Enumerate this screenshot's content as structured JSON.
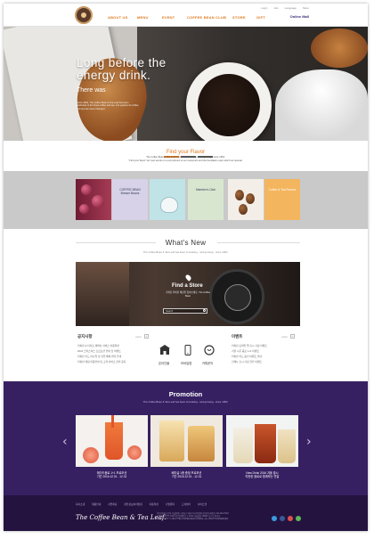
{
  "header": {
    "nav": [
      "ABOUT US",
      "MENU",
      "EVENT",
      "COFFEE BEAN CLUB",
      "STORE",
      "GIFT"
    ],
    "utilities": [
      "Login",
      "Join",
      "Language",
      "Store"
    ],
    "online_mall": "Online Mall"
  },
  "hero": {
    "title": "Long before the energy drink.",
    "subtitle": "There was",
    "copy": "Since 1963, The Coffee Bean & Tea Leaf has been dedicated to the finest coffee and tea. Our passion for coffee and tea has never changed."
  },
  "flavor": {
    "title": "Find your Flavor",
    "desc_1": "The Coffee Bean & Tea Leaf has been innovating - and growing - since 1963.",
    "desc_2": "\"Find your flavor\" isn't just words on a commitment to our customers and the foundation upon which we operate."
  },
  "categories": [
    {
      "label": ""
    },
    {
      "label": "COFFEE BEAN Brewer Beans"
    },
    {
      "label": ""
    },
    {
      "label": "Member's Club"
    },
    {
      "label": ""
    },
    {
      "label": "Coffee & Tea Flavors"
    }
  ],
  "whats_new": {
    "title": "What's New",
    "subtitle": "The Coffee Bean & Tea Leaf has been innovating - and growing - since 1963."
  },
  "store_finder": {
    "title": "Find a Store",
    "copy": "가까운 커피빈 매장을 찾아보세요. The Coffee Bean",
    "search_placeholder": "Search"
  },
  "notices": {
    "title": "공지사항",
    "more": "more",
    "items": [
      "커피빈 & 티리프 멤버십 서비스 이용약관",
      "2016 크리스마스 프로모션 안내 및 이벤트",
      "커피빈 카드 리뉴얼 및 적립 혜택 변경 안내",
      "커피빈 매장 이용안내 및 고객 서비스 관련 공지"
    ]
  },
  "services": [
    {
      "label": "온라인몰",
      "icon": "store-icon"
    },
    {
      "label": "모바일앱",
      "icon": "mobile-icon"
    },
    {
      "label": "카톡문의",
      "icon": "chat-icon"
    }
  ],
  "events": {
    "title": "이벤트",
    "more": "more",
    "items": [
      "커피빈 모바일 앱 출시 기념 이벤트",
      "겨울 시즌 음료 1+1 이벤트",
      "커피빈 카드 충전 이벤트 안내",
      "신메뉴 출시 기념 할인 이벤트"
    ]
  },
  "promotion": {
    "title": "Promotion",
    "subtitle": "The Coffee Bean & Tea Leaf has been innovating - and growing - since 1963.",
    "cards": [
      {
        "caption_1": "에이드음료 1+1 프로모션",
        "caption_2": "기간 2016.12.01 - 12.31"
      },
      {
        "caption_1": "베이글 1종 증정 프로모션",
        "caption_2": "기간 2016.12.01 - 12.31"
      },
      {
        "caption_1": "New Drink 2016 겨울 출시",
        "caption_2": "따듯한 음료로 함께하는 연말"
      }
    ],
    "prev": "‹",
    "next": "›"
  },
  "footer": {
    "links": [
      "회사소개",
      "채용안내",
      "사업제휴",
      "개인정보처리방침",
      "이용약관",
      "가맹문의",
      "고객센터",
      "사이트맵"
    ],
    "logo": "The Coffee Bean & Tea Leaf.",
    "info_1": "(주)커피빈코리아 서울특별시 강남구 대표이사 박상배 사업자등록번호 211-86-27316",
    "info_2": "고객센터 1577-7000 통신판매업신고 2011-서울강남-00000 호스팅 제공자",
    "info_3": "COPYRIGHT © 2016 THE COFFEE BEAN KOREA. ALL RIGHTS RESERVED."
  },
  "colors": {
    "accent": "#e07a1f",
    "promo_bg": "#372062",
    "footer_bg": "#24133f"
  }
}
